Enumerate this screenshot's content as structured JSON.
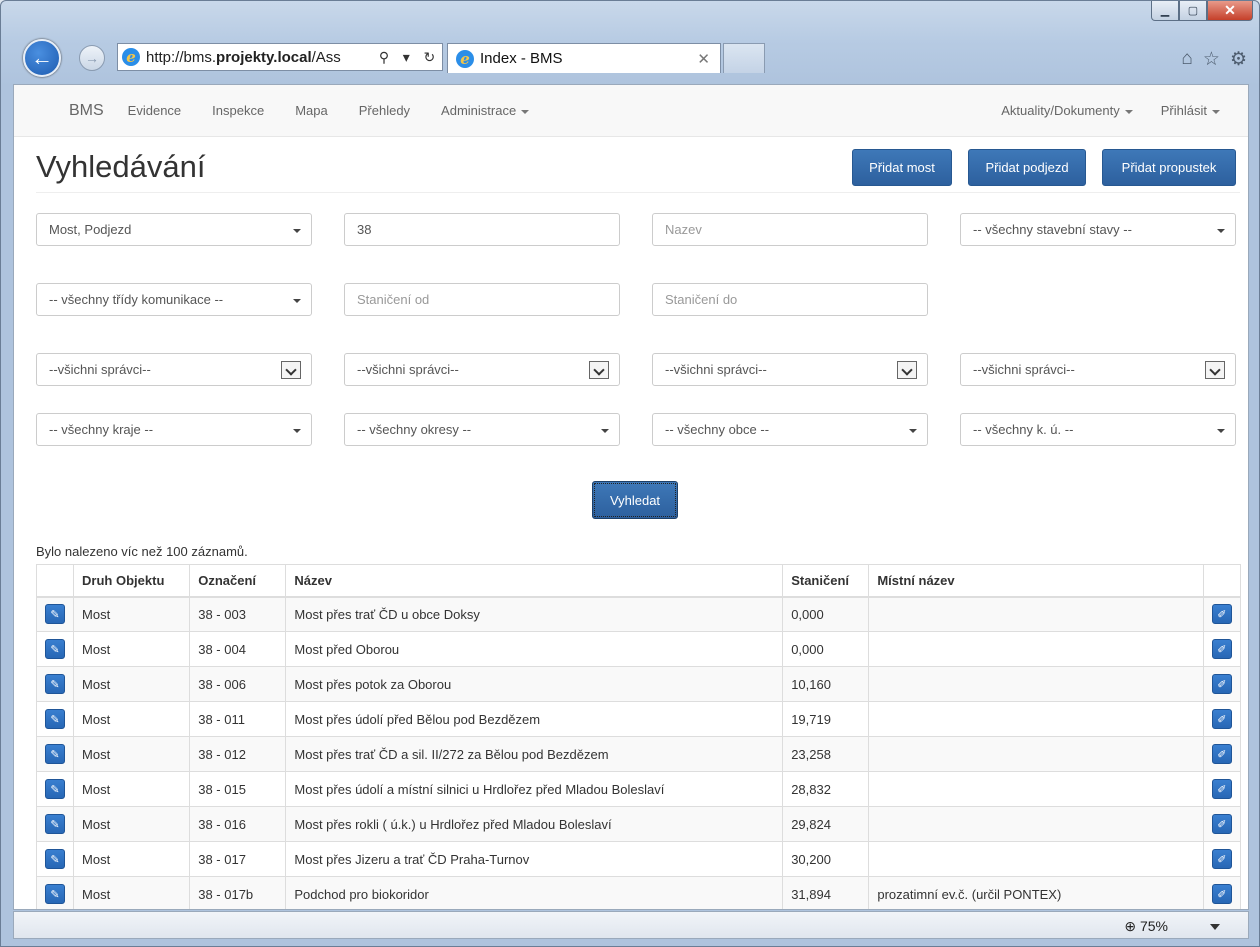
{
  "browser": {
    "address_prefix": "http://bms.",
    "address_domain": "projekty.local",
    "address_suffix": "/Ass",
    "tab_title": "Index - BMS",
    "zoom": "75%"
  },
  "navbar": {
    "brand": "BMS",
    "items": [
      "Evidence",
      "Inspekce",
      "Mapa",
      "Přehledy",
      "Administrace"
    ],
    "right_items": [
      "Aktuality/Dokumenty",
      "Přihlásit"
    ]
  },
  "header": {
    "title": "Vyhledávání",
    "buttons": [
      "Přidat most",
      "Přidat podjezd",
      "Přidat propustek"
    ]
  },
  "filters": {
    "object_type": "Most, Podjezd",
    "designation": "38",
    "name_placeholder": "Nazev",
    "building_state": "-- všechny stavební stavy --",
    "road_class": "-- všechny třídy komunikace --",
    "station_from_placeholder": "Staničení od",
    "station_to_placeholder": "Staničení do",
    "managers": [
      "--všichni správci--",
      "--všichni správci--",
      "--všichni správci--",
      "--všichni správci--"
    ],
    "region": "-- všechny kraje --",
    "district": "-- všechny okresy --",
    "municipality": "-- všechny obce --",
    "cadastral": "-- všechny k. ú. --"
  },
  "search_button": "Vyhledat",
  "result_info": "Bylo nalezeno víc než 100 záznamů.",
  "table": {
    "headers": [
      "Druh Objektu",
      "Označení",
      "Název",
      "Staničení",
      "Místní název"
    ],
    "rows": [
      [
        "Most",
        "38 - 003",
        "Most přes trať ČD u obce Doksy",
        "0,000",
        ""
      ],
      [
        "Most",
        "38 - 004",
        "Most před Oborou",
        "0,000",
        ""
      ],
      [
        "Most",
        "38 - 006",
        "Most přes potok za Oborou",
        "10,160",
        ""
      ],
      [
        "Most",
        "38 - 011",
        "Most přes údolí před Bělou pod Bezdězem",
        "19,719",
        ""
      ],
      [
        "Most",
        "38 - 012",
        "Most přes trať ČD a sil. II/272 za Bělou pod Bezdězem",
        "23,258",
        ""
      ],
      [
        "Most",
        "38 - 015",
        "Most přes údolí a místní silnici u Hrdlořez před Mladou Boleslaví",
        "28,832",
        ""
      ],
      [
        "Most",
        "38 - 016",
        "Most přes rokli ( ú.k.) u Hrdlořez před Mladou Boleslaví",
        "29,824",
        ""
      ],
      [
        "Most",
        "38 - 017",
        "Most přes Jizeru a trať ČD Praha-Turnov",
        "30,200",
        ""
      ],
      [
        "Most",
        "38 - 017b",
        "Podchod pro biokoridor",
        "31,894",
        "prozatimní ev.č. (určil PONTEX)"
      ]
    ]
  }
}
